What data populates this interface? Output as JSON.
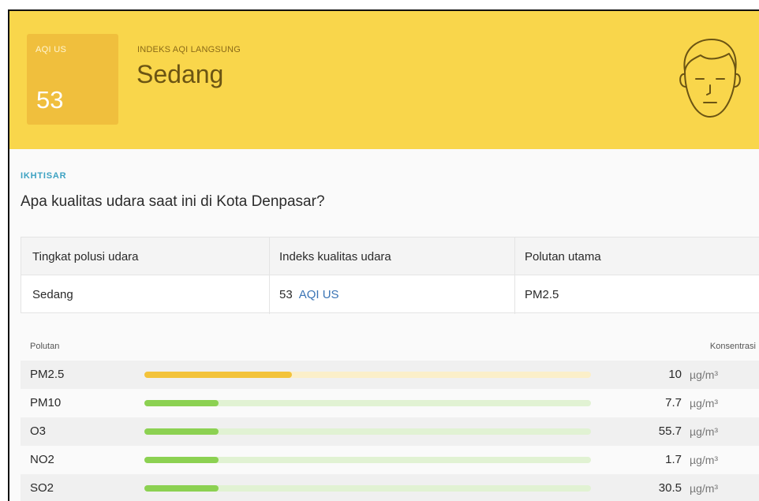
{
  "header": {
    "aqi_label": "AQI US",
    "aqi_value": "53",
    "live_label": "INDEKS AQI LANGSUNG",
    "status": "Sedang",
    "face_icon": "neutral-face-icon",
    "colors": {
      "banner": "#f9d64b",
      "aqi_box": "#f0bf3d"
    }
  },
  "summary": {
    "tag": "IKHTISAR",
    "question": "Apa kualitas udara saat ini di Kota Denpasar?",
    "columns": [
      "Tingkat polusi udara",
      "Indeks kualitas udara",
      "Polutan utama"
    ],
    "level": "Sedang",
    "aqi_value": "53",
    "aqi_unit": "AQI US",
    "main_pollutant": "PM2.5"
  },
  "pollutants": {
    "col_name": "Polutan",
    "col_conc": "Konsentrasi",
    "unit": "µg/m³",
    "rows": [
      {
        "name": "PM2.5",
        "value": "10",
        "level": 0.33,
        "color": "#f3c33b",
        "track": "#fbefc9"
      },
      {
        "name": "PM10",
        "value": "7.7",
        "level": 0.166,
        "color": "#8cd152",
        "track": "#e1f2d3"
      },
      {
        "name": "O3",
        "value": "55.7",
        "level": 0.166,
        "color": "#8cd152",
        "track": "#e1f2d3"
      },
      {
        "name": "NO2",
        "value": "1.7",
        "level": 0.166,
        "color": "#8cd152",
        "track": "#e1f2d3"
      },
      {
        "name": "SO2",
        "value": "30.5",
        "level": 0.166,
        "color": "#8cd152",
        "track": "#e1f2d3"
      }
    ]
  }
}
